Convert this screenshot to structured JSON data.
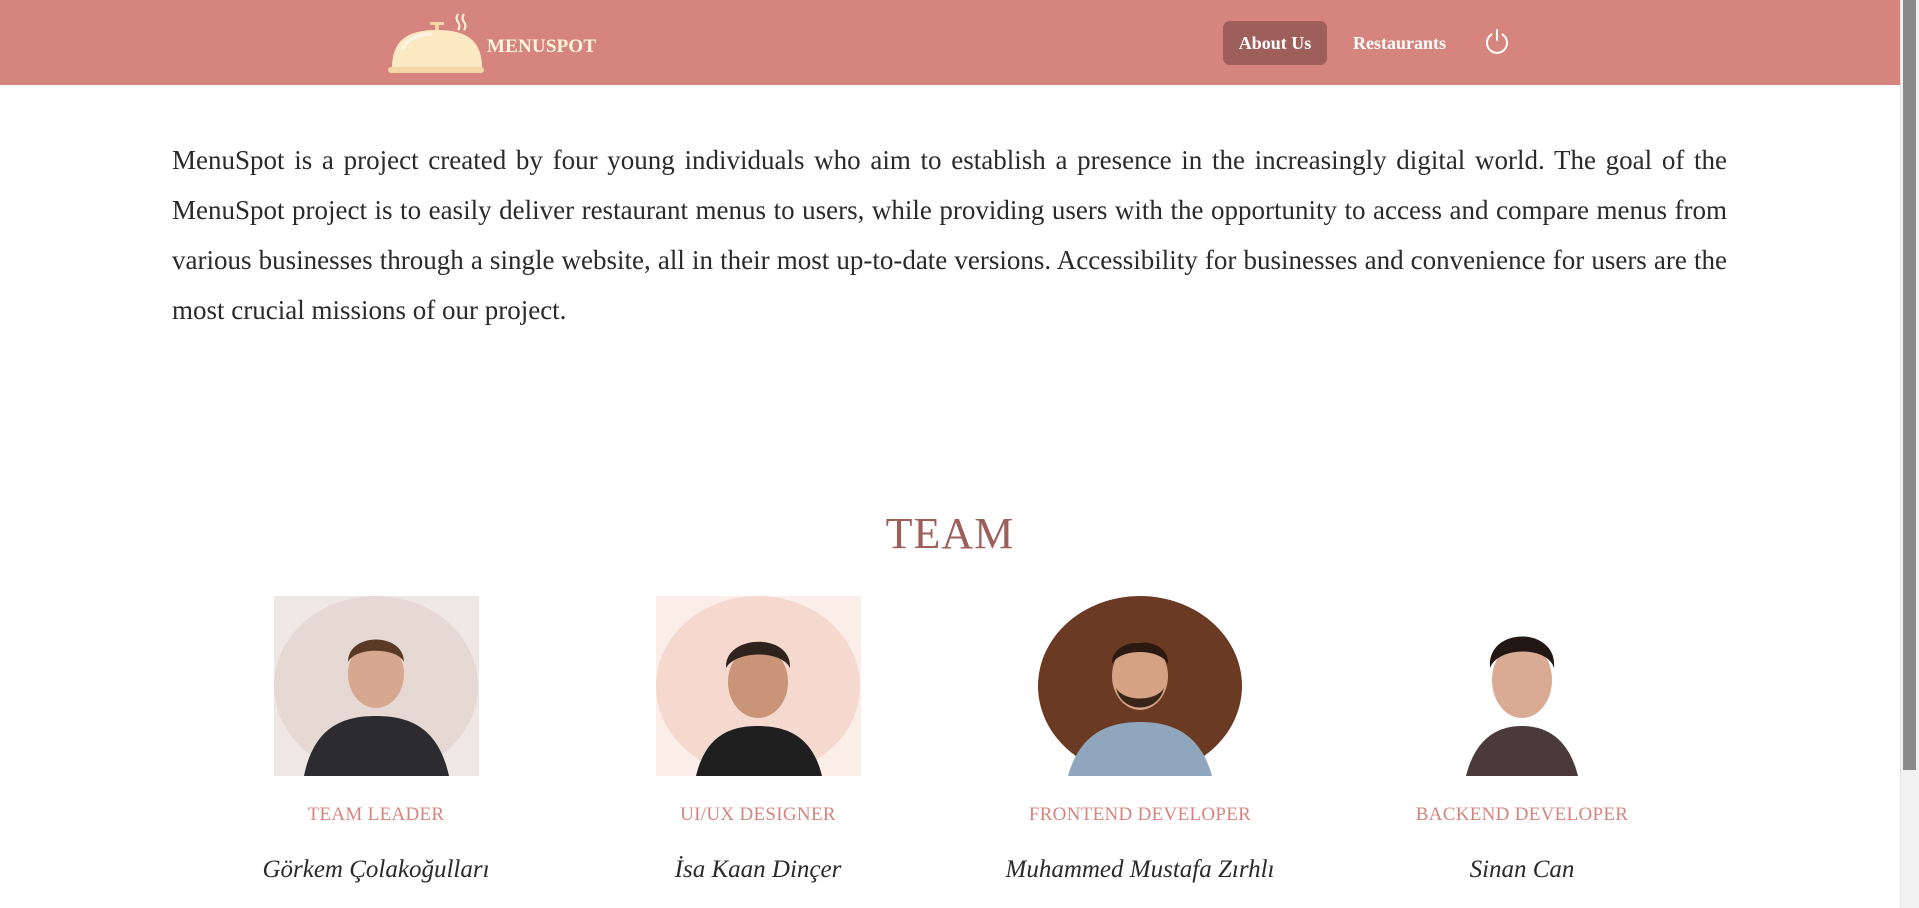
{
  "header": {
    "brand": "MENUSPOT",
    "nav": {
      "about": "About Us",
      "restaurants": "Restaurants"
    },
    "power_icon": "power-icon",
    "logo_icon": "cloche-icon",
    "colors": {
      "bar": "#d5857d",
      "active": "#9e5e59",
      "brand_text": "#fff6df"
    }
  },
  "intro": {
    "text": "MenuSpot is a project created by four young individuals who aim to establish a presence in the increasingly digital world. The goal of the MenuSpot project is to easily deliver restaurant menus to users, while providing users with the opportunity to access and compare menus from various businesses through a single website, all in their most up-to-date versions. Accessibility for businesses and convenience for users are the most crucial missions of our project."
  },
  "team": {
    "title": "TEAM",
    "members": [
      {
        "role": "TEAM LEADER",
        "name": "Görkem Çolakoğulları"
      },
      {
        "role": "UI/UX DESIGNER",
        "name": "İsa Kaan Dinçer"
      },
      {
        "role": "FRONTEND DEVELOPER",
        "name": "Muhammed Mustafa Zırhlı"
      },
      {
        "role": "BACKEND DEVELOPER",
        "name": "Sinan Can"
      }
    ]
  }
}
